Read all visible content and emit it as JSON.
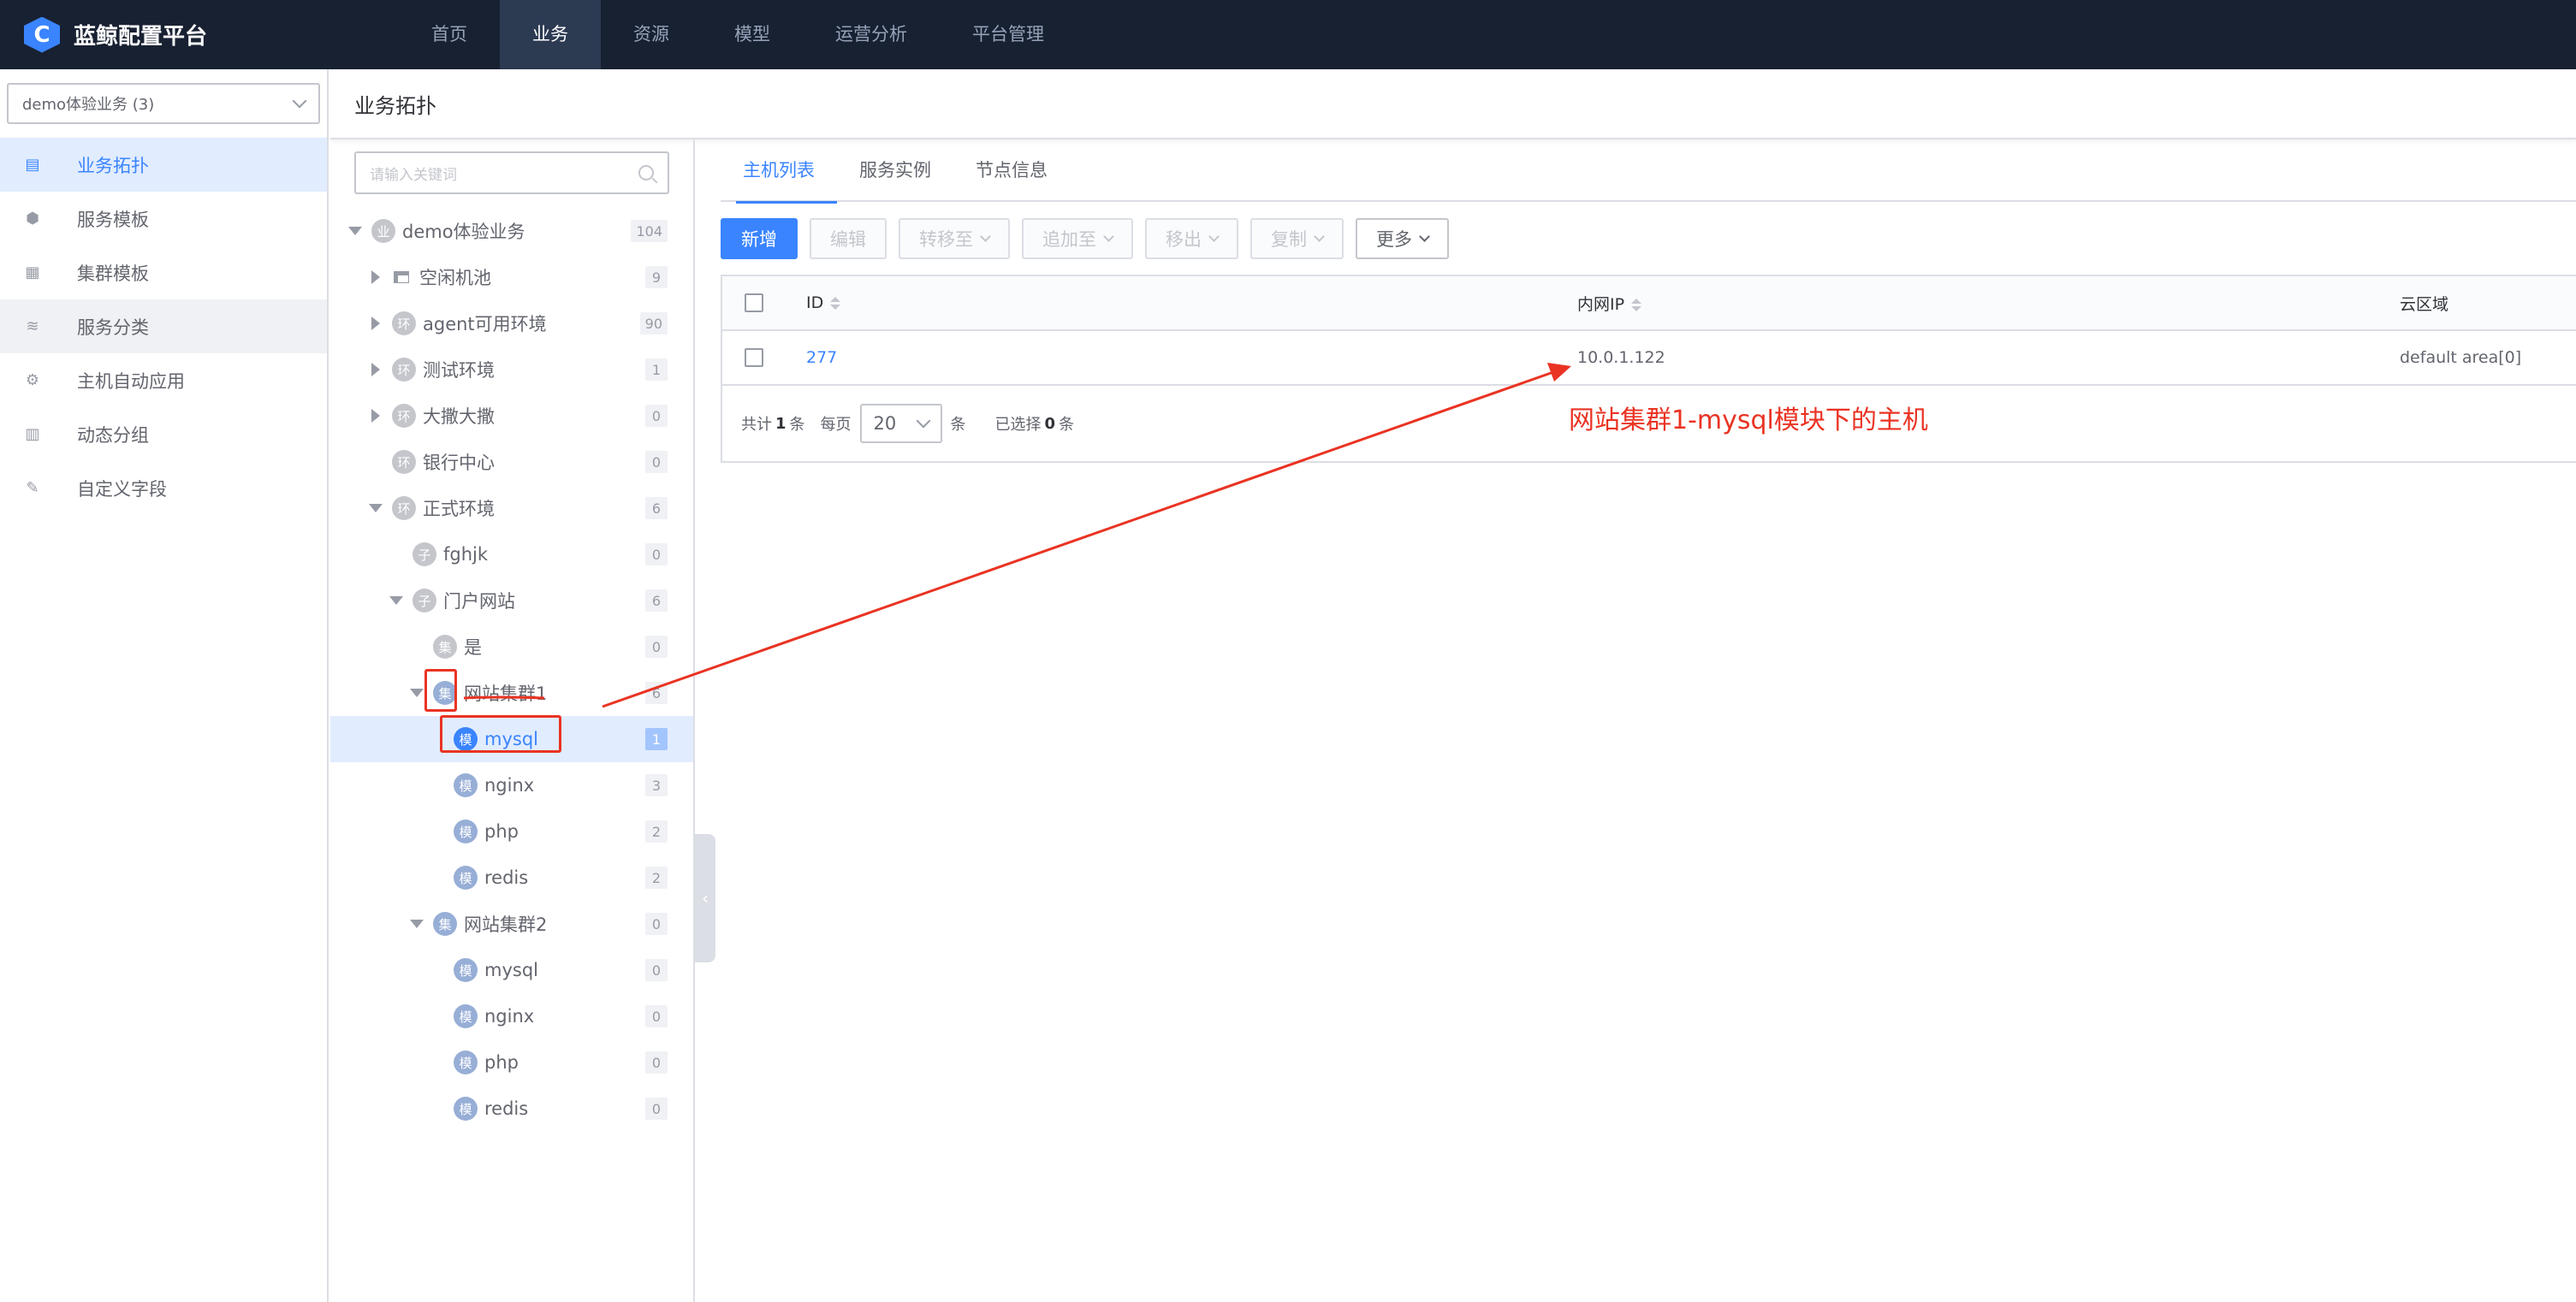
{
  "app": {
    "title": "蓝鲸配置平台",
    "logo_letter": "C",
    "accent": "#3a84ff",
    "nav_bg": "#182132"
  },
  "topnav": {
    "items": [
      {
        "label": "首页",
        "active": false
      },
      {
        "label": "业务",
        "active": true
      },
      {
        "label": "资源",
        "active": false
      },
      {
        "label": "模型",
        "active": false
      },
      {
        "label": "运营分析",
        "active": false
      },
      {
        "label": "平台管理",
        "active": false
      }
    ]
  },
  "sidebar": {
    "business_select": "demo体验业务 (3)",
    "items": [
      {
        "label": "业务拓扑",
        "icon": "topology-icon",
        "active": true
      },
      {
        "label": "服务模板",
        "icon": "cube-icon",
        "active": false
      },
      {
        "label": "集群模板",
        "icon": "grid-icon",
        "active": false
      },
      {
        "label": "服务分类",
        "icon": "layers-icon",
        "active": false
      },
      {
        "label": "主机自动应用",
        "icon": "gear-icon",
        "active": false
      },
      {
        "label": "动态分组",
        "icon": "group-icon",
        "active": false
      },
      {
        "label": "自定义字段",
        "icon": "edit-icon",
        "active": false
      }
    ]
  },
  "page": {
    "title": "业务拓扑"
  },
  "tree": {
    "search_placeholder": "请输入关键词",
    "nodes": [
      {
        "label": "demo体验业务",
        "badge": "业",
        "count": "104",
        "level": 0,
        "arrow": "down"
      },
      {
        "label": "空闲机池",
        "badge": "",
        "count": "9",
        "level": 1,
        "arrow": "right",
        "folder": true
      },
      {
        "label": "agent可用环境",
        "badge": "环",
        "count": "90",
        "level": 1,
        "arrow": "right"
      },
      {
        "label": "测试环境",
        "badge": "环",
        "count": "1",
        "level": 1,
        "arrow": "right"
      },
      {
        "label": "大撒大撒",
        "badge": "环",
        "count": "0",
        "level": 1,
        "arrow": "right"
      },
      {
        "label": "银行中心",
        "badge": "环",
        "count": "0",
        "level": 1,
        "arrow": ""
      },
      {
        "label": "正式环境",
        "badge": "环",
        "count": "6",
        "level": 1,
        "arrow": "down"
      },
      {
        "label": "fghjk",
        "badge": "子",
        "count": "0",
        "level": 2,
        "arrow": ""
      },
      {
        "label": "门户网站",
        "badge": "子",
        "count": "6",
        "level": 2,
        "arrow": "down"
      },
      {
        "label": "是",
        "badge": "集",
        "count": "0",
        "level": 3,
        "arrow": ""
      },
      {
        "label": "网站集群1",
        "badge": "集",
        "count": "6",
        "level": 3,
        "arrow": "down"
      },
      {
        "label": "mysql",
        "badge": "模",
        "count": "1",
        "level": 4,
        "arrow": "",
        "selected": true
      },
      {
        "label": "nginx",
        "badge": "模",
        "count": "3",
        "level": 4,
        "arrow": ""
      },
      {
        "label": "php",
        "badge": "模",
        "count": "2",
        "level": 4,
        "arrow": ""
      },
      {
        "label": "redis",
        "badge": "模",
        "count": "2",
        "level": 4,
        "arrow": ""
      },
      {
        "label": "网站集群2",
        "badge": "集",
        "count": "0",
        "level": 3,
        "arrow": "down"
      },
      {
        "label": "mysql",
        "badge": "模",
        "count": "0",
        "level": 4,
        "arrow": ""
      },
      {
        "label": "nginx",
        "badge": "模",
        "count": "0",
        "level": 4,
        "arrow": ""
      },
      {
        "label": "php",
        "badge": "模",
        "count": "0",
        "level": 4,
        "arrow": ""
      },
      {
        "label": "redis",
        "badge": "模",
        "count": "0",
        "level": 4,
        "arrow": ""
      }
    ]
  },
  "tabs": [
    {
      "label": "主机列表",
      "active": true
    },
    {
      "label": "服务实例",
      "active": false
    },
    {
      "label": "节点信息",
      "active": false
    }
  ],
  "toolbar": {
    "add": "新增",
    "edit": "编辑",
    "transfer": "转移至",
    "append": "追加至",
    "remove": "移出",
    "copy": "复制",
    "more": "更多"
  },
  "table": {
    "columns": [
      "ID",
      "内网IP",
      "云区域"
    ],
    "rows": [
      {
        "id": "277",
        "ip": "10.0.1.122",
        "cloud": "default area[0]"
      }
    ]
  },
  "pagination": {
    "total_prefix": "共计",
    "total": "1",
    "total_unit": "条",
    "per_page_label": "每页",
    "page_size": "20",
    "page_size_unit": "条",
    "selected_prefix": "已选择",
    "selected": "0",
    "selected_unit": "条"
  },
  "annotation": {
    "text": "网站集群1-mysql模块下的主机",
    "color": "#ea3323"
  }
}
